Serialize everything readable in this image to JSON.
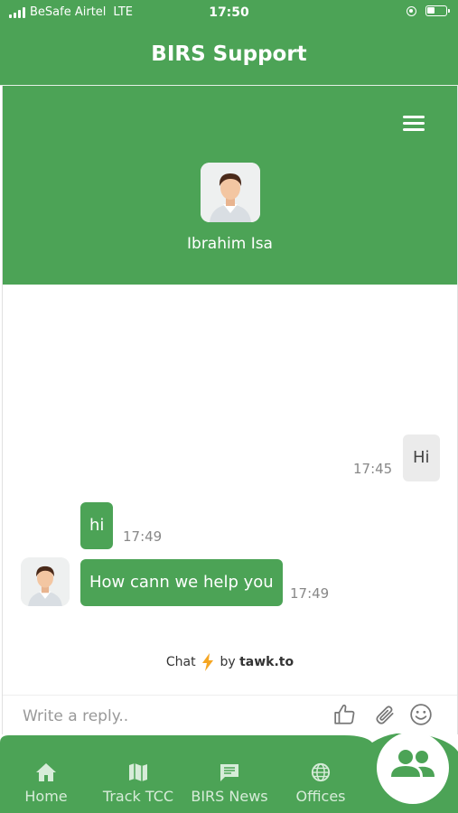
{
  "status_bar": {
    "carrier": "BeSafe Airtel",
    "network": "LTE",
    "time": "17:50"
  },
  "header": {
    "title": "BIRS Support"
  },
  "agent": {
    "name": "Ibrahim Isa"
  },
  "messages": [
    {
      "from": "visitor",
      "text": "Hi",
      "time": "17:45"
    },
    {
      "from": "agent",
      "text": "hi",
      "time": "17:49"
    },
    {
      "from": "agent",
      "text": "How cann we help you",
      "time": "17:49"
    }
  ],
  "branding": {
    "prefix": "Chat",
    "by": "by",
    "brand": "tawk.to"
  },
  "composer": {
    "placeholder": "Write a reply..",
    "icons": [
      "thumbs-up-icon",
      "paperclip-icon",
      "emoji-icon"
    ]
  },
  "tabs": [
    {
      "label": "Home",
      "icon": "home-icon"
    },
    {
      "label": "Track TCC",
      "icon": "map-icon"
    },
    {
      "label": "BIRS News",
      "icon": "chat-icon"
    },
    {
      "label": "Offices",
      "icon": "globe-icon"
    }
  ],
  "fab": {
    "icon": "people-icon"
  },
  "colors": {
    "primary": "#4CA356",
    "visitor_bubble": "#EBEBEB",
    "time_text": "#888888"
  }
}
